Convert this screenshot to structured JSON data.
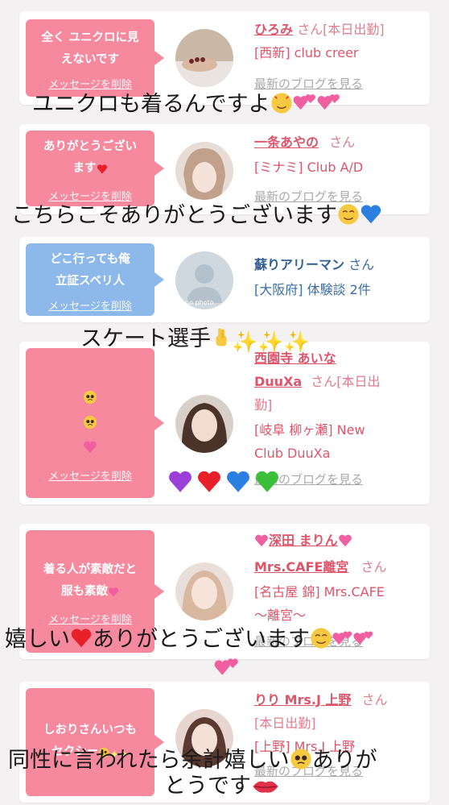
{
  "cards": [
    {
      "bubble_text": "全く ユニクロに見\nえないです",
      "delete_label": "メッセージを削除",
      "name": "ひろみ",
      "honorific": "さん",
      "line1": "[本日出勤]",
      "shop": "[西新] club creer",
      "blog_label": "最新のブログを見る"
    },
    {
      "bubble_text": "ありがとうござい\nます",
      "delete_label": "メッセージを削除",
      "name": "一条あやの",
      "honorific": "さん",
      "shop": "[ミナミ] Club A/D",
      "blog_label": "最新のブログを見る"
    },
    {
      "bubble_text": "どこ行っても俺\n立証スベリ人",
      "delete_label": "メッセージを削除",
      "name": "蘇りアリーマン",
      "honorific": "さん",
      "shop": "[大阪府] 体験談 2件",
      "avatar_text": "no photo"
    },
    {
      "delete_label": "メッセージを削除",
      "name": "西園寺 あいな",
      "name2": "DuuXa",
      "honorific": "さん[本日出",
      "line1": "勤]",
      "shop": "[岐阜 柳ヶ瀬] New",
      "shop2": "Club DuuXa",
      "blog_label": "最新のブログを見る"
    },
    {
      "bubble_text": "着る人が素敵だと\n服も素敵",
      "delete_label": "メッセージを削除",
      "name": "深田 まりん",
      "name2": "Mrs.CAFE離宮",
      "honorific": "さん",
      "shop": "[名古屋 錦] Mrs.CAFE",
      "shop2": "〜離宮〜",
      "blog_label": "最新のブログを見る"
    },
    {
      "bubble_text": "しおりさんいつも\nセクシー",
      "name": "りり Mrs.J 上野",
      "honorific": "さん",
      "line1": "[本日出勤]",
      "shop": "[上野] Mrs.J 上野",
      "blog_label": "最新のブログを見る"
    }
  ],
  "overlays": {
    "o1": "ユニクロも着るんですよ",
    "o2": "こちらこそありがとうございます",
    "o3": "スケート選手",
    "o4": "嬉しい",
    "o4b": "ありがとうございます",
    "o5": "同性に言われたら余計嬉しい",
    "o5b": "ありが",
    "o5c": "とうです"
  },
  "colors": {
    "pink_bubble": "#f6899e",
    "blue_bubble": "#8db8ea",
    "name_pink": "#e0546a",
    "name_blue": "#2f5f95"
  }
}
